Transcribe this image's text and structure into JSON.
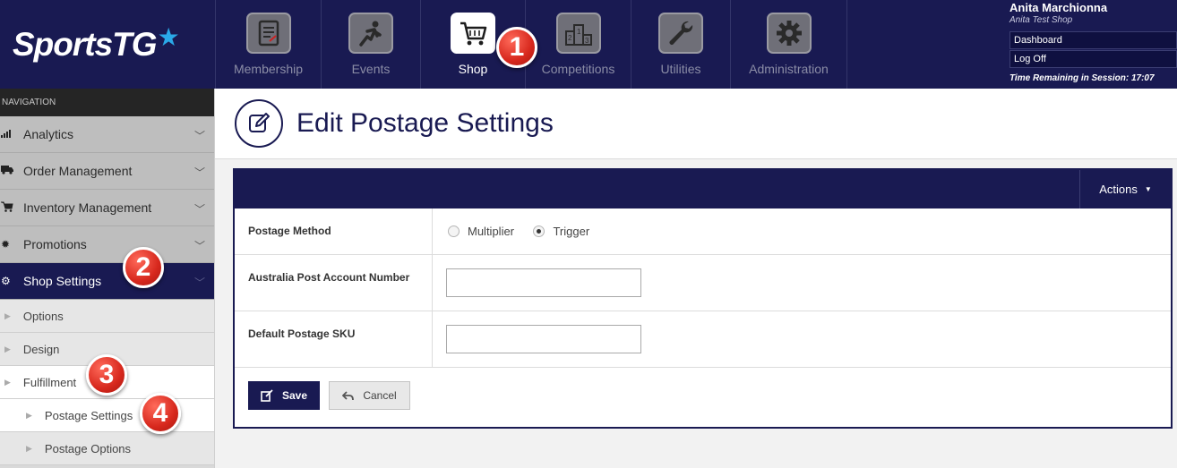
{
  "brand": {
    "logo_text": "SportsTG",
    "logo_star": "★"
  },
  "top_nav": {
    "items": [
      {
        "label": "Membership",
        "icon": "membership-icon"
      },
      {
        "label": "Events",
        "icon": "events-icon"
      },
      {
        "label": "Shop",
        "icon": "shop-cart-icon",
        "active": true
      },
      {
        "label": "Competitions",
        "icon": "podium-icon"
      },
      {
        "label": "Utilities",
        "icon": "wrench-icon"
      },
      {
        "label": "Administration",
        "icon": "gear-icon"
      }
    ]
  },
  "user": {
    "name": "Anita Marchionna",
    "shop": "Anita Test Shop",
    "dashboard_link": "Dashboard",
    "logoff_link": "Log Off",
    "session_text": "Time Remaining in Session: 17:07"
  },
  "sidebar": {
    "heading": "NAVIGATION",
    "items": [
      {
        "label": "Analytics",
        "icon": "bar-chart-icon"
      },
      {
        "label": "Order Management",
        "icon": "truck-icon"
      },
      {
        "label": "Inventory Management",
        "icon": "cart-icon"
      },
      {
        "label": "Promotions",
        "icon": "burst-icon"
      },
      {
        "label": "Shop Settings",
        "icon": "cogs-icon",
        "active": true
      }
    ],
    "sub_items": [
      {
        "label": "Options"
      },
      {
        "label": "Design"
      },
      {
        "label": "Fulfillment"
      }
    ],
    "sub_sub_items": [
      {
        "label": "Postage Settings"
      },
      {
        "label": "Postage Options"
      }
    ]
  },
  "badges": {
    "b1": "1",
    "b2": "2",
    "b3": "3",
    "b4": "4"
  },
  "page": {
    "title": "Edit Postage Settings",
    "actions_label": "Actions",
    "fields": {
      "postage_method_label": "Postage Method",
      "postage_method_options": [
        "Multiplier",
        "Trigger"
      ],
      "postage_method_selected": "Trigger",
      "ap_account_label": "Australia Post Account Number",
      "ap_account_value": "",
      "default_sku_label": "Default Postage SKU",
      "default_sku_value": ""
    },
    "save_label": "Save",
    "cancel_label": "Cancel"
  },
  "colors": {
    "navy": "#191a52",
    "badge_red": "#d7281d",
    "accent_blue": "#2aa9e8"
  }
}
